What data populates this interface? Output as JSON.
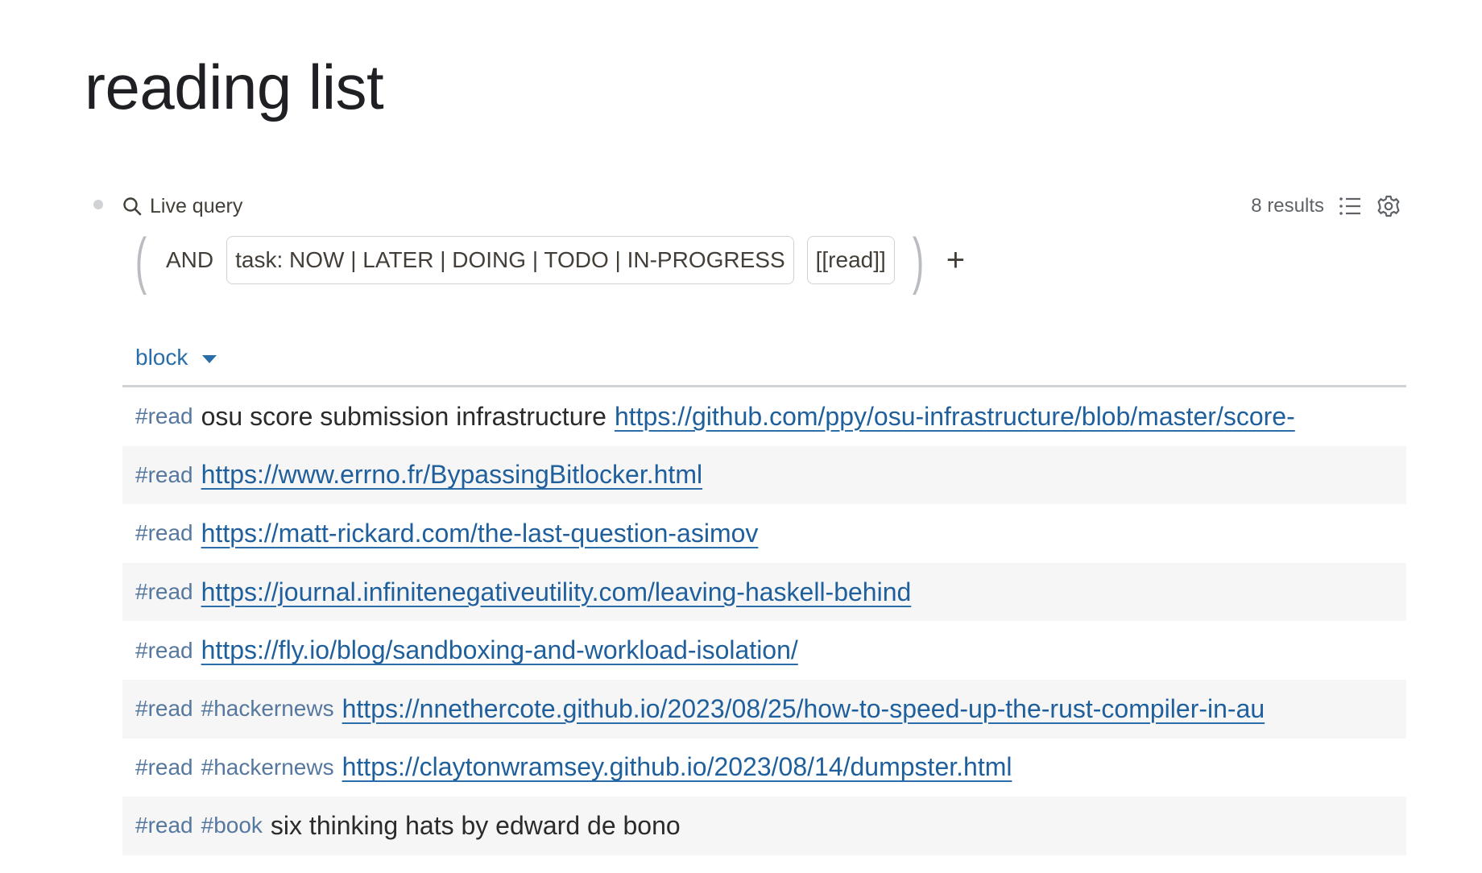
{
  "page": {
    "title": "reading list"
  },
  "query": {
    "label": "Live query",
    "results": "8 results",
    "operator": "AND",
    "clauses": [
      "task: NOW | LATER | DOING | TODO | IN-PROGRESS",
      "[[read]]"
    ],
    "add_symbol": "+",
    "paren_open": "(",
    "paren_close": ")"
  },
  "table": {
    "column": "block",
    "rows": [
      {
        "tags": [
          "#read"
        ],
        "text": "osu score submission infrastructure",
        "link": "https://github.com/ppy/osu-infrastructure/blob/master/score-"
      },
      {
        "tags": [
          "#read"
        ],
        "text": "",
        "link": "https://www.errno.fr/BypassingBitlocker.html"
      },
      {
        "tags": [
          "#read"
        ],
        "text": "",
        "link": "https://matt-rickard.com/the-last-question-asimov"
      },
      {
        "tags": [
          "#read"
        ],
        "text": "",
        "link": "https://journal.infinitenegativeutility.com/leaving-haskell-behind"
      },
      {
        "tags": [
          "#read"
        ],
        "text": "",
        "link": "https://fly.io/blog/sandboxing-and-workload-isolation/"
      },
      {
        "tags": [
          "#read",
          "#hackernews"
        ],
        "text": "",
        "link": "https://nnethercote.github.io/2023/08/25/how-to-speed-up-the-rust-compiler-in-au"
      },
      {
        "tags": [
          "#read",
          "#hackernews"
        ],
        "text": "",
        "link": "https://claytonwramsey.github.io/2023/08/14/dumpster.html"
      },
      {
        "tags": [
          "#read",
          "#book"
        ],
        "text": "six thinking hats by edward de bono",
        "link": ""
      }
    ]
  },
  "icons": {
    "search": "search-icon",
    "list": "list-icon",
    "settings": "gear-icon",
    "caret": "caret-down-icon"
  },
  "colors": {
    "accent": "#2a6da8",
    "tag": "#56789e",
    "alt_row": "#f6f6f7"
  }
}
